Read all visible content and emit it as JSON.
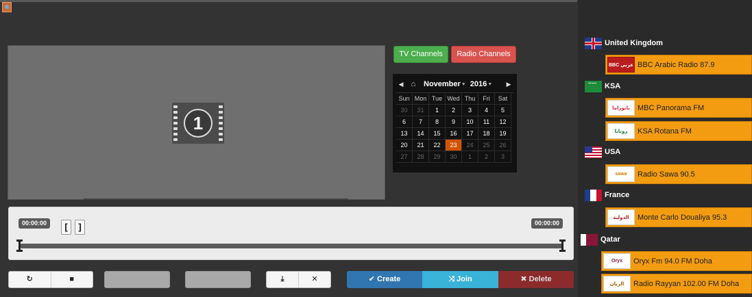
{
  "player": {
    "leader_digit": "1"
  },
  "channel_tabs": {
    "tv_label": "TV Channels",
    "radio_label": "Radio Channels",
    "tv_color": "#4cae4c",
    "radio_color": "#d9534f"
  },
  "calendar": {
    "month": "November",
    "year": "2016",
    "weekdays": [
      "Sun",
      "Mon",
      "Tue",
      "Wed",
      "Thu",
      "Fri",
      "Sat"
    ],
    "weeks": [
      [
        "30",
        "31",
        "1",
        "2",
        "3",
        "4",
        "5"
      ],
      [
        "6",
        "7",
        "8",
        "9",
        "10",
        "11",
        "12"
      ],
      [
        "13",
        "14",
        "15",
        "16",
        "17",
        "18",
        "19"
      ],
      [
        "20",
        "21",
        "22",
        "23",
        "24",
        "25",
        "26"
      ],
      [
        "27",
        "28",
        "29",
        "30",
        "1",
        "2",
        "3"
      ]
    ],
    "selected_day": "23",
    "selected_color": "#d35400"
  },
  "timeline": {
    "start_time": "00:00:00",
    "end_time": "00:00:00",
    "mark_in_label": "[",
    "mark_out_label": "]"
  },
  "controls": {
    "refresh_icon": "refresh-icon",
    "stop_icon": "stop-icon",
    "download_icon": "download-icon",
    "clear_icon": "close-icon"
  },
  "actions": {
    "create_label": "Create",
    "join_label": "Join",
    "delete_label": "Delete",
    "create_color": "#3276b1",
    "join_color": "#39b3d7",
    "delete_color": "#8b2b2b"
  },
  "stations": {
    "uk": {
      "country": "United Kingdom",
      "items": [
        {
          "name": "BBC Arabic Radio 87.9",
          "logo_text": "BBC عربي"
        }
      ]
    },
    "ksa": {
      "country": "KSA",
      "items": [
        {
          "name": "MBC Panorama FM",
          "logo_text": "بانوراما"
        },
        {
          "name": "KSA Rotana FM",
          "logo_text": "روتانا"
        }
      ]
    },
    "usa": {
      "country": "USA",
      "items": [
        {
          "name": "Radio Sawa 90.5",
          "logo_text": "sawa"
        }
      ]
    },
    "france": {
      "country": "France",
      "items": [
        {
          "name": "Monte Carlo Doualiya 95.3",
          "logo_text": "الدولية"
        }
      ]
    },
    "qatar": {
      "country": "Qatar",
      "items": [
        {
          "name": "Oryx Fm 94.0 FM Doha",
          "logo_text": "Oryx"
        },
        {
          "name": "Radio Rayyan 102.00 FM Doha",
          "logo_text": "الريان"
        }
      ]
    },
    "item_color": "#f39c12"
  }
}
